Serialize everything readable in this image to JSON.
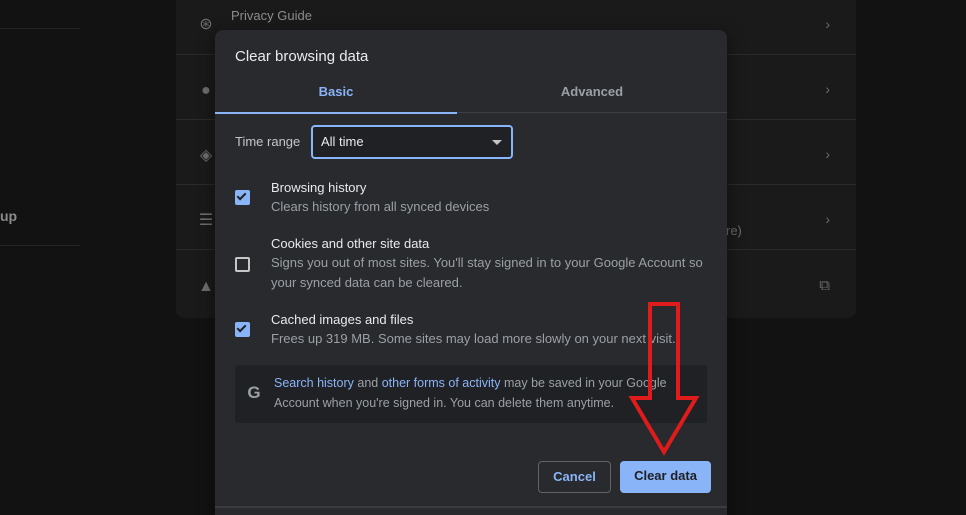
{
  "background": {
    "left_label": "up",
    "rows": [
      {
        "icon": "compass-icon",
        "label": "Privacy Guide"
      },
      {
        "icon": "cookie-icon",
        "label": ""
      },
      {
        "icon": "shield-icon",
        "label": ""
      },
      {
        "icon": "sliders-icon",
        "label": "",
        "extra": "re)"
      },
      {
        "icon": "flask-icon",
        "label": ""
      }
    ]
  },
  "dialog": {
    "title": "Clear browsing data",
    "tabs": [
      {
        "label": "Basic",
        "active": true
      },
      {
        "label": "Advanced",
        "active": false
      }
    ],
    "time_range": {
      "label": "Time range",
      "value": "All time"
    },
    "options": [
      {
        "title": "Browsing history",
        "description": "Clears history from all synced devices",
        "checked": true
      },
      {
        "title": "Cookies and other site data",
        "description": "Signs you out of most sites. You'll stay signed in to your Google Account so your synced data can be cleared.",
        "checked": false
      },
      {
        "title": "Cached images and files",
        "description": "Frees up 319 MB. Some sites may load more slowly on your next visit.",
        "checked": true
      }
    ],
    "info": {
      "icon": "google-g-icon",
      "link1": "Search history",
      "connector": " and ",
      "link2": "other forms of activity",
      "rest": " may be saved in your Google Account when you're signed in. You can delete them anytime."
    },
    "buttons": {
      "cancel": "Cancel",
      "clear": "Clear data"
    }
  },
  "colors": {
    "accent": "#8ab4f8",
    "dialog_bg": "#292a2d",
    "annotation": "#e01b1b"
  }
}
